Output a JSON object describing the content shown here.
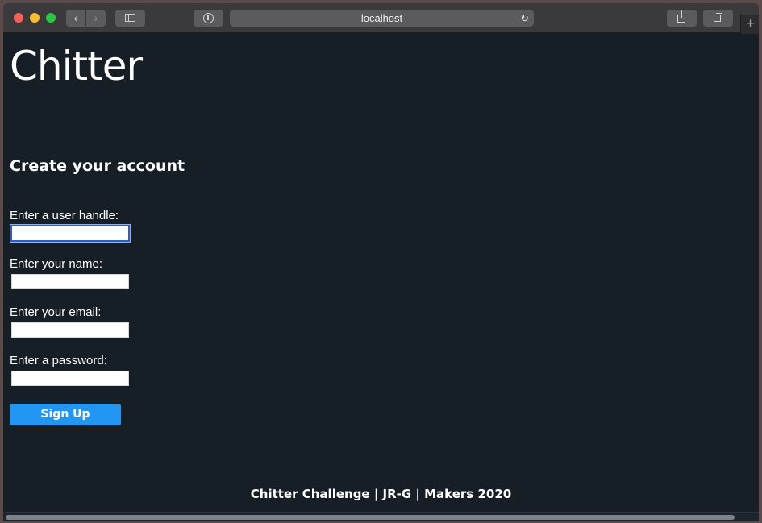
{
  "browser": {
    "address": "localhost",
    "reload_glyph": "↻",
    "back_glyph": "‹",
    "forward_glyph": "›",
    "new_tab_glyph": "+"
  },
  "page": {
    "logo": "Chitter",
    "heading": "Create your account",
    "fields": [
      {
        "label": "Enter a user handle:",
        "value": "",
        "focused": true
      },
      {
        "label": "Enter your name:",
        "value": ""
      },
      {
        "label": "Enter your email:",
        "value": ""
      },
      {
        "label": "Enter a password:",
        "value": ""
      }
    ],
    "submit_label": "Sign Up",
    "footer": "Chitter Challenge | JR-G | Makers 2020"
  },
  "colors": {
    "background": "#161e26",
    "button": "#2196f3",
    "text": "#ffffff"
  }
}
